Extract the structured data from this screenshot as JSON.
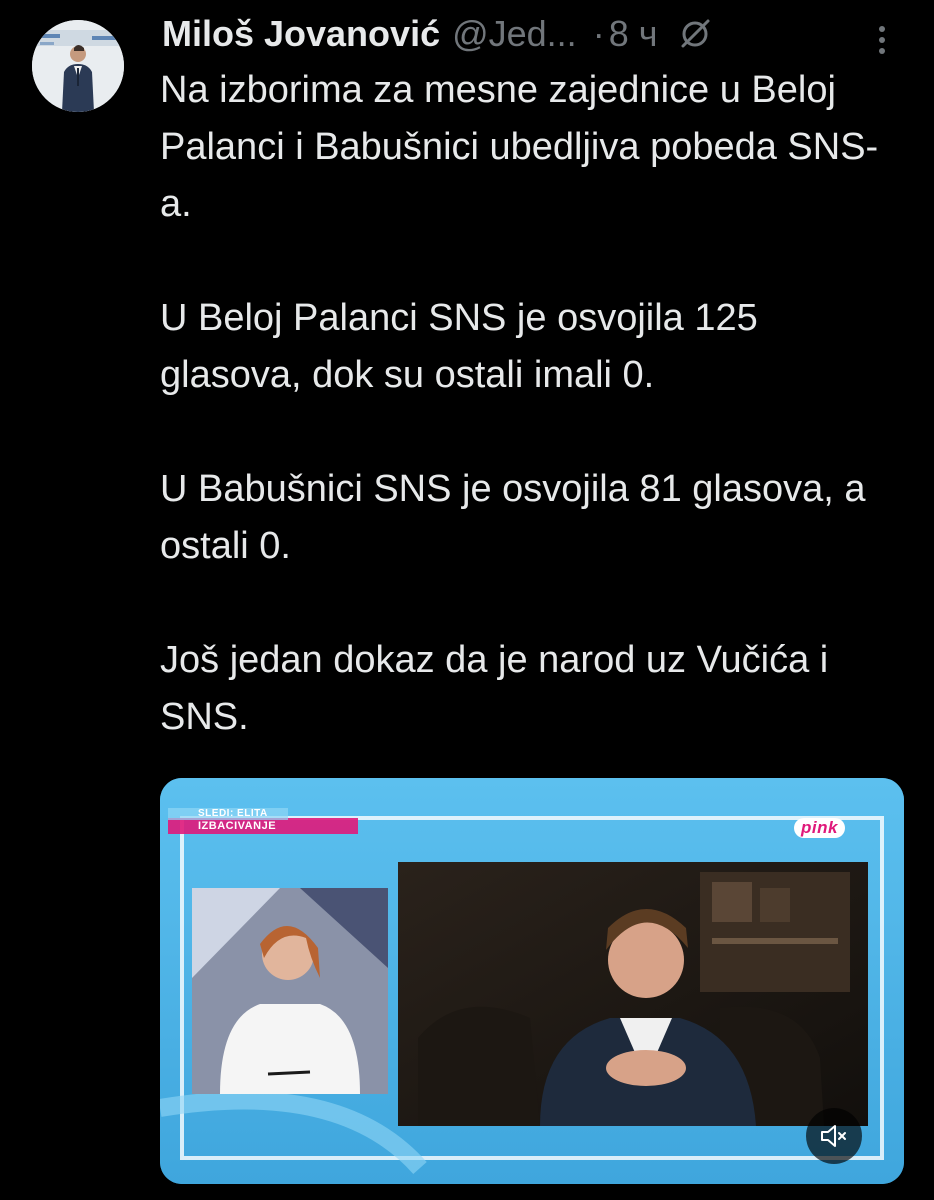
{
  "author": {
    "display_name": "Miloš Jovanović",
    "handle": "@Jed...",
    "separator": "·",
    "time": "8 ч"
  },
  "tweet": {
    "paragraphs": [
      "Na izborima za mesne zajednice u Beloj Palanci i Babušnici ubedljiva pobeda SNS-a.",
      "U Beloj Palanci SNS je osvojila 125 glasova, dok su ostali imali 0.",
      "U Babušnici SNS je osvojila 81 glasova, a ostali 0.",
      "Još jedan dokaz da je narod uz Vučića i SNS."
    ]
  },
  "media": {
    "tv_overlay_top": "SLEDI: ELITA",
    "tv_overlay_bottom": "IZBACIVANJE",
    "channel_logo": "pink"
  },
  "colors": {
    "background": "#000000",
    "text_primary": "#e7e9ea",
    "text_secondary": "#71767b",
    "studio_blue": "#4fb3e8",
    "banner_pink": "#e0187a"
  },
  "icons": {
    "grok": "slashed-circle-icon",
    "more": "vertical-ellipsis-icon",
    "mute": "speaker-muted-icon"
  }
}
